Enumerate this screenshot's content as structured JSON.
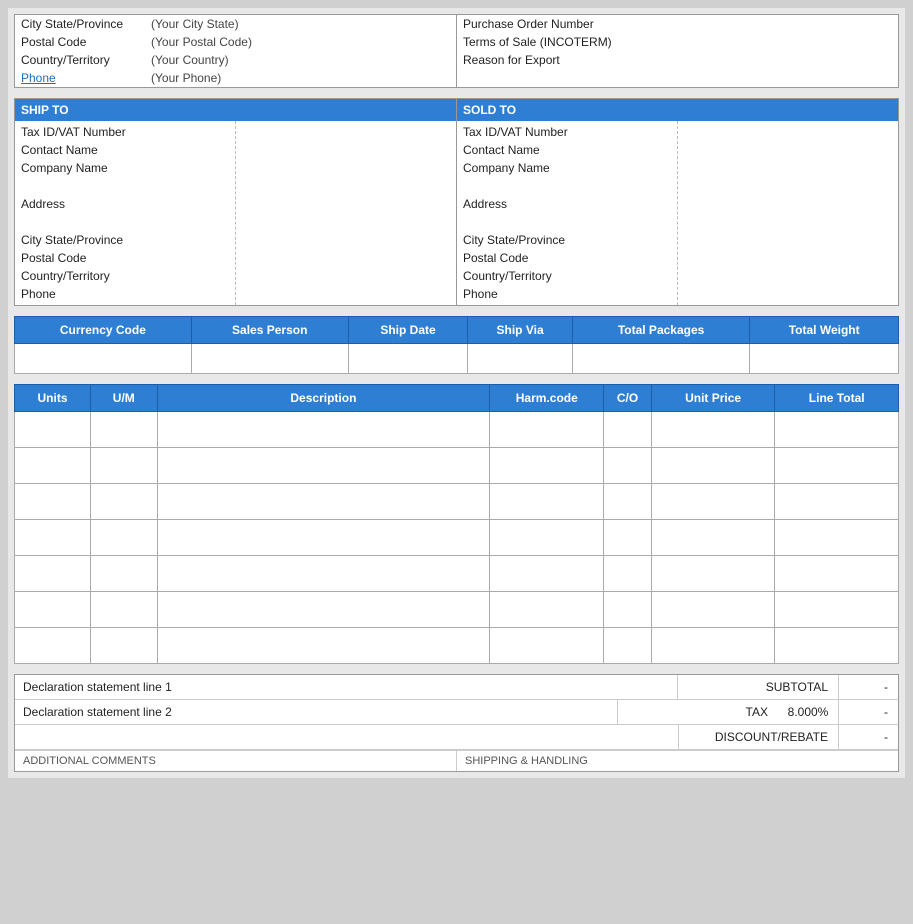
{
  "top_address": {
    "left": {
      "rows": [
        {
          "label": "City State/Province",
          "value": "(Your City State)"
        },
        {
          "label": "Postal Code",
          "value": "(Your Postal Code)"
        },
        {
          "label": "Country/Territory",
          "value": "(Your Country)"
        },
        {
          "label": "Phone",
          "value": "(Your Phone)",
          "link": true
        }
      ]
    },
    "right": {
      "rows": [
        {
          "label": "Purchase Order Number",
          "value": ""
        },
        {
          "label": "Terms of Sale (INCOTERM)",
          "value": ""
        },
        {
          "label": "Reason for Export",
          "value": ""
        }
      ]
    }
  },
  "ship_sold": {
    "ship_to": {
      "header": "SHIP TO",
      "labels": [
        "Tax ID/VAT Number",
        "Contact Name",
        "Company Name",
        "",
        "Address",
        "",
        "City  State/Province",
        "Postal Code",
        "Country/Territory",
        "Phone"
      ]
    },
    "sold_to": {
      "header": "SOLD TO",
      "labels": [
        "Tax ID/VAT Number",
        "Contact Name",
        "Company Name",
        "",
        "Address",
        "",
        "City  State/Province",
        "Postal Code",
        "Country/Territory",
        "Phone"
      ]
    }
  },
  "shipping_info": {
    "columns": [
      "Currency Code",
      "Sales Person",
      "Ship Date",
      "Ship Via",
      "Total Packages",
      "Total Weight"
    ]
  },
  "line_items": {
    "columns": [
      {
        "label": "Units",
        "width": "8%"
      },
      {
        "label": "U/M",
        "width": "7%"
      },
      {
        "label": "Description",
        "width": "35%"
      },
      {
        "label": "Harm.code",
        "width": "12%"
      },
      {
        "label": "C/O",
        "width": "5%"
      },
      {
        "label": "Unit Price",
        "width": "13%"
      },
      {
        "label": "Line Total",
        "width": "13%"
      }
    ],
    "empty_rows": 7
  },
  "totals": {
    "declaration_line1": "Declaration statement line 1",
    "declaration_line2": "Declaration statement line 2",
    "subtotal_label": "SUBTOTAL",
    "subtotal_value": "-",
    "tax_label": "TAX",
    "tax_rate": "8.000%",
    "tax_value": "-",
    "discount_label": "DISCOUNT/REBATE",
    "discount_value": "-"
  },
  "bottom": {
    "left": "ADDITIONAL COMMENTS",
    "right": "SHIPPING & HANDLING"
  }
}
